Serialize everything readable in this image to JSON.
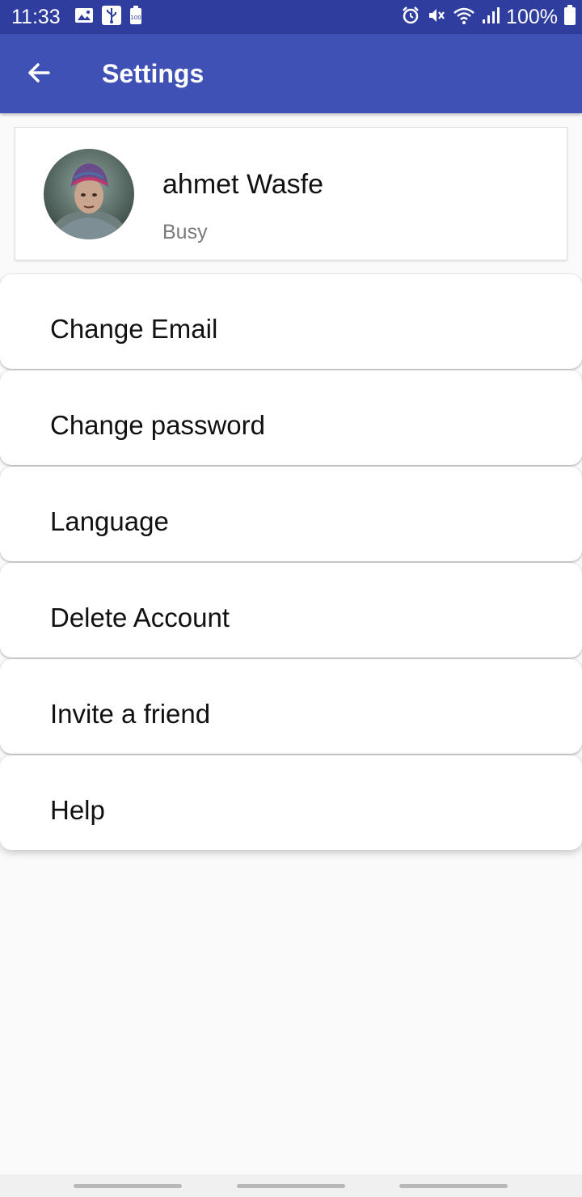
{
  "status_bar": {
    "time": "11:33",
    "battery_level": "100%",
    "left_icons": [
      "image-icon",
      "usb-icon",
      "battery-saver-icon"
    ],
    "right_icons": [
      "alarm-icon",
      "mute-icon",
      "wifi-icon",
      "signal-icon",
      "battery-icon"
    ]
  },
  "app_bar": {
    "title": "Settings",
    "back_icon": "arrow-left-icon",
    "color": "#3f51b5"
  },
  "profile": {
    "name": "ahmet Wasfe",
    "status": "Busy"
  },
  "settings": {
    "items": [
      {
        "label": "Change Email"
      },
      {
        "label": "Change password"
      },
      {
        "label": "Language"
      },
      {
        "label": "Delete Account"
      },
      {
        "label": "Invite a friend"
      },
      {
        "label": "Help"
      }
    ]
  },
  "colors": {
    "status_bar": "#2f3e9e",
    "accent": "#3f51b5",
    "background": "#fafafa",
    "secondary_text": "#7a7a7a"
  }
}
